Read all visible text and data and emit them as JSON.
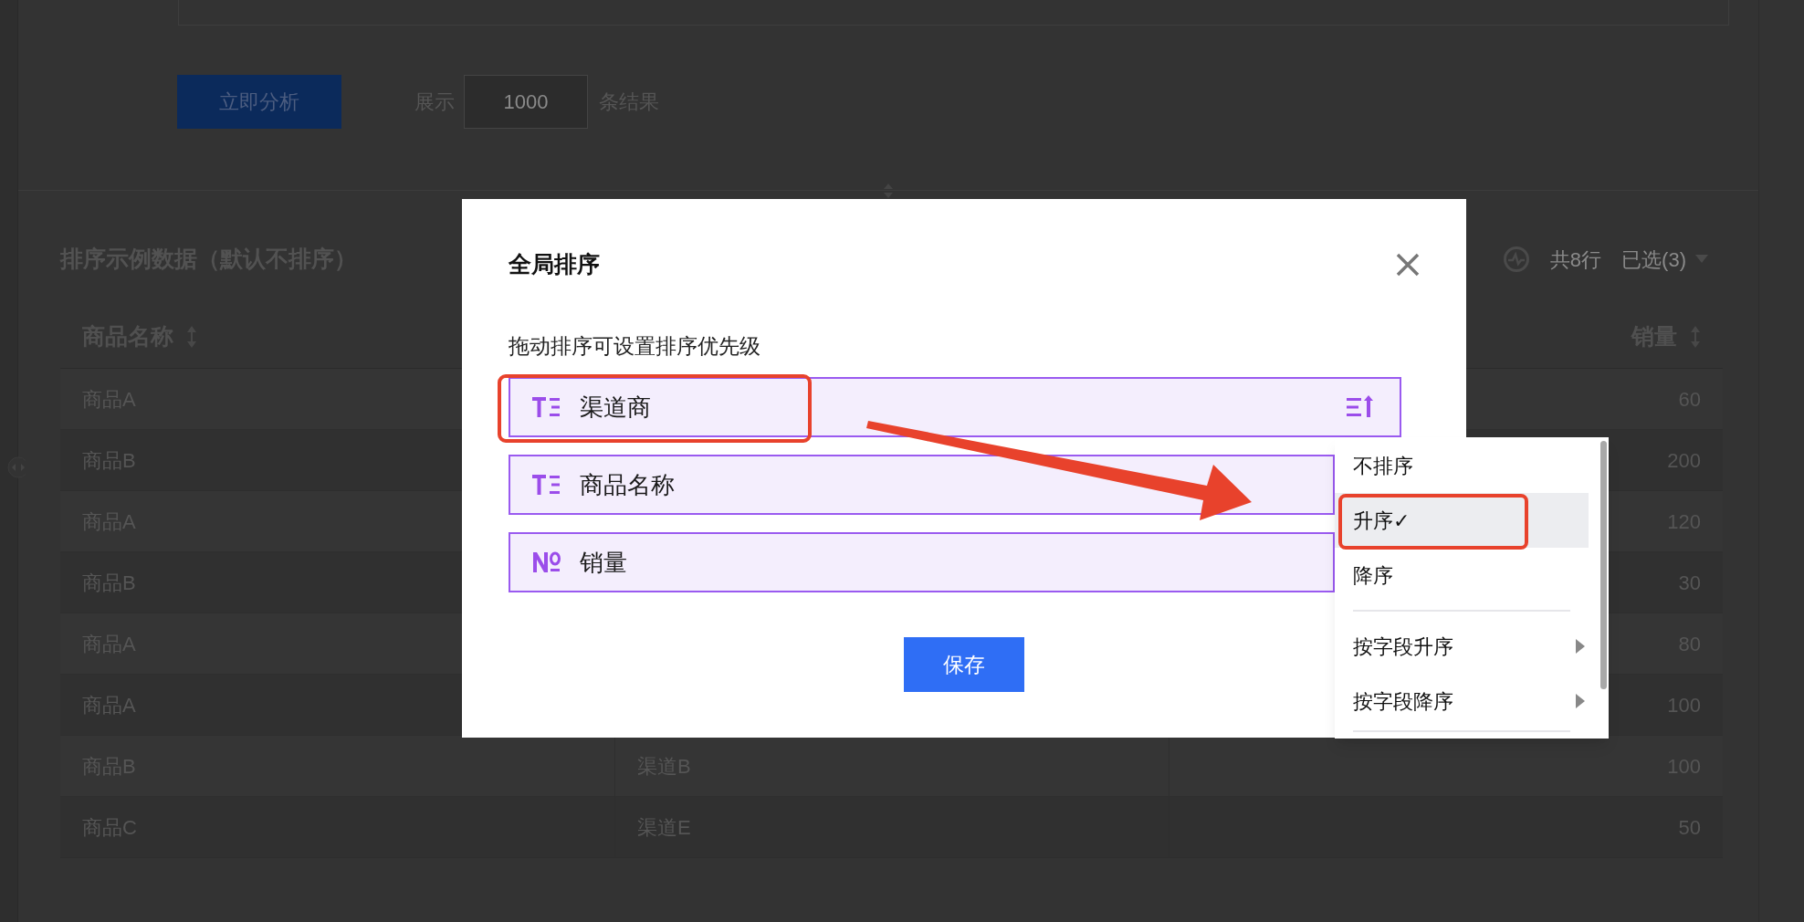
{
  "toolbar": {
    "analyze_button": "立即分析",
    "show_label": "展示",
    "count": "1000",
    "result_label": "条结果"
  },
  "section": {
    "title": "排序示例数据（默认不排序）",
    "row_count": "共8行",
    "selected_count": "已选(3)"
  },
  "table": {
    "columns": [
      {
        "label": "商品名称"
      },
      {
        "label": "销量"
      }
    ],
    "rows": [
      {
        "product": "商品A",
        "sales": "60"
      },
      {
        "product": "商品B",
        "sales": "200"
      },
      {
        "product": "商品A",
        "sales": "120"
      },
      {
        "product": "商品B",
        "sales": "30"
      },
      {
        "product": "商品A",
        "sales": "80"
      },
      {
        "product": "商品A",
        "sales": "100"
      },
      {
        "product": "商品B",
        "channel": "渠道B",
        "sales": "100"
      },
      {
        "product": "商品C",
        "channel": "渠道E",
        "sales": "50"
      }
    ]
  },
  "modal": {
    "title": "全局排序",
    "hint": "拖动排序可设置排序优先级",
    "fields": [
      {
        "label": "渠道商",
        "kind": "text",
        "sorted": true
      },
      {
        "label": "商品名称",
        "kind": "text",
        "sorted": false
      },
      {
        "label": "销量",
        "kind": "number",
        "sorted": false
      }
    ],
    "save_button": "保存"
  },
  "sort_menu": {
    "items": [
      {
        "label": "不排序",
        "selected": false,
        "submenu": false
      },
      {
        "label": "升序✓",
        "selected": true,
        "submenu": false
      },
      {
        "label": "降序",
        "selected": false,
        "submenu": false
      },
      {
        "label": "按字段升序",
        "selected": false,
        "submenu": true
      },
      {
        "label": "按字段降序",
        "selected": false,
        "submenu": true
      }
    ]
  }
}
